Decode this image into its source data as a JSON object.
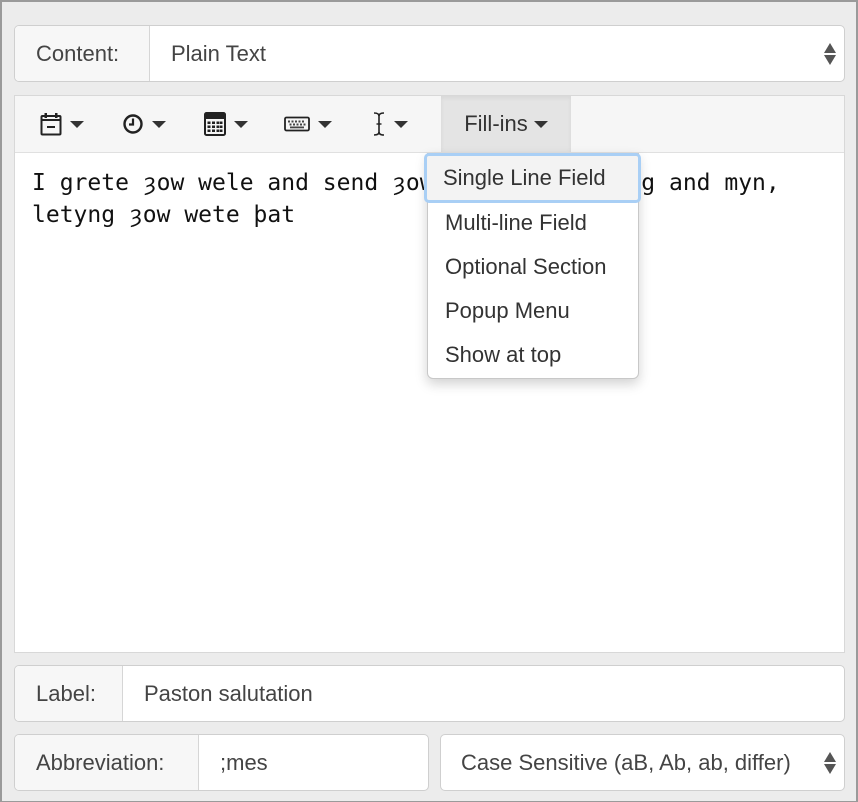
{
  "content": {
    "label": "Content:",
    "value": "Plain Text"
  },
  "toolbar": {
    "buttons": [
      {
        "icon": "calendar-icon"
      },
      {
        "icon": "clock-icon"
      },
      {
        "icon": "calculator-icon"
      },
      {
        "icon": "keyboard-icon"
      },
      {
        "icon": "text-cursor-icon"
      }
    ],
    "fillins_label": "Fill-ins"
  },
  "editor": {
    "text": "I grete ȝow wele and send ȝow goddys blyssyng and myn, letyng ȝow wete þat"
  },
  "fillins_menu": {
    "items": [
      {
        "label": "Single Line Field",
        "highlighted": true
      },
      {
        "label": "Multi-line Field"
      },
      {
        "label": "Optional Section"
      },
      {
        "label": "Popup Menu"
      },
      {
        "label": "Show at top"
      }
    ]
  },
  "label_field": {
    "label": "Label:",
    "value": "Paston salutation"
  },
  "abbreviation_field": {
    "label": "Abbreviation:",
    "value": ";mes"
  },
  "case_select": {
    "value": "Case Sensitive (aB, Ab, ab, differ)"
  },
  "colors": {
    "background": "#ececec",
    "focus_ring": "#a9cff5",
    "active_button": "#e4e4e4"
  }
}
